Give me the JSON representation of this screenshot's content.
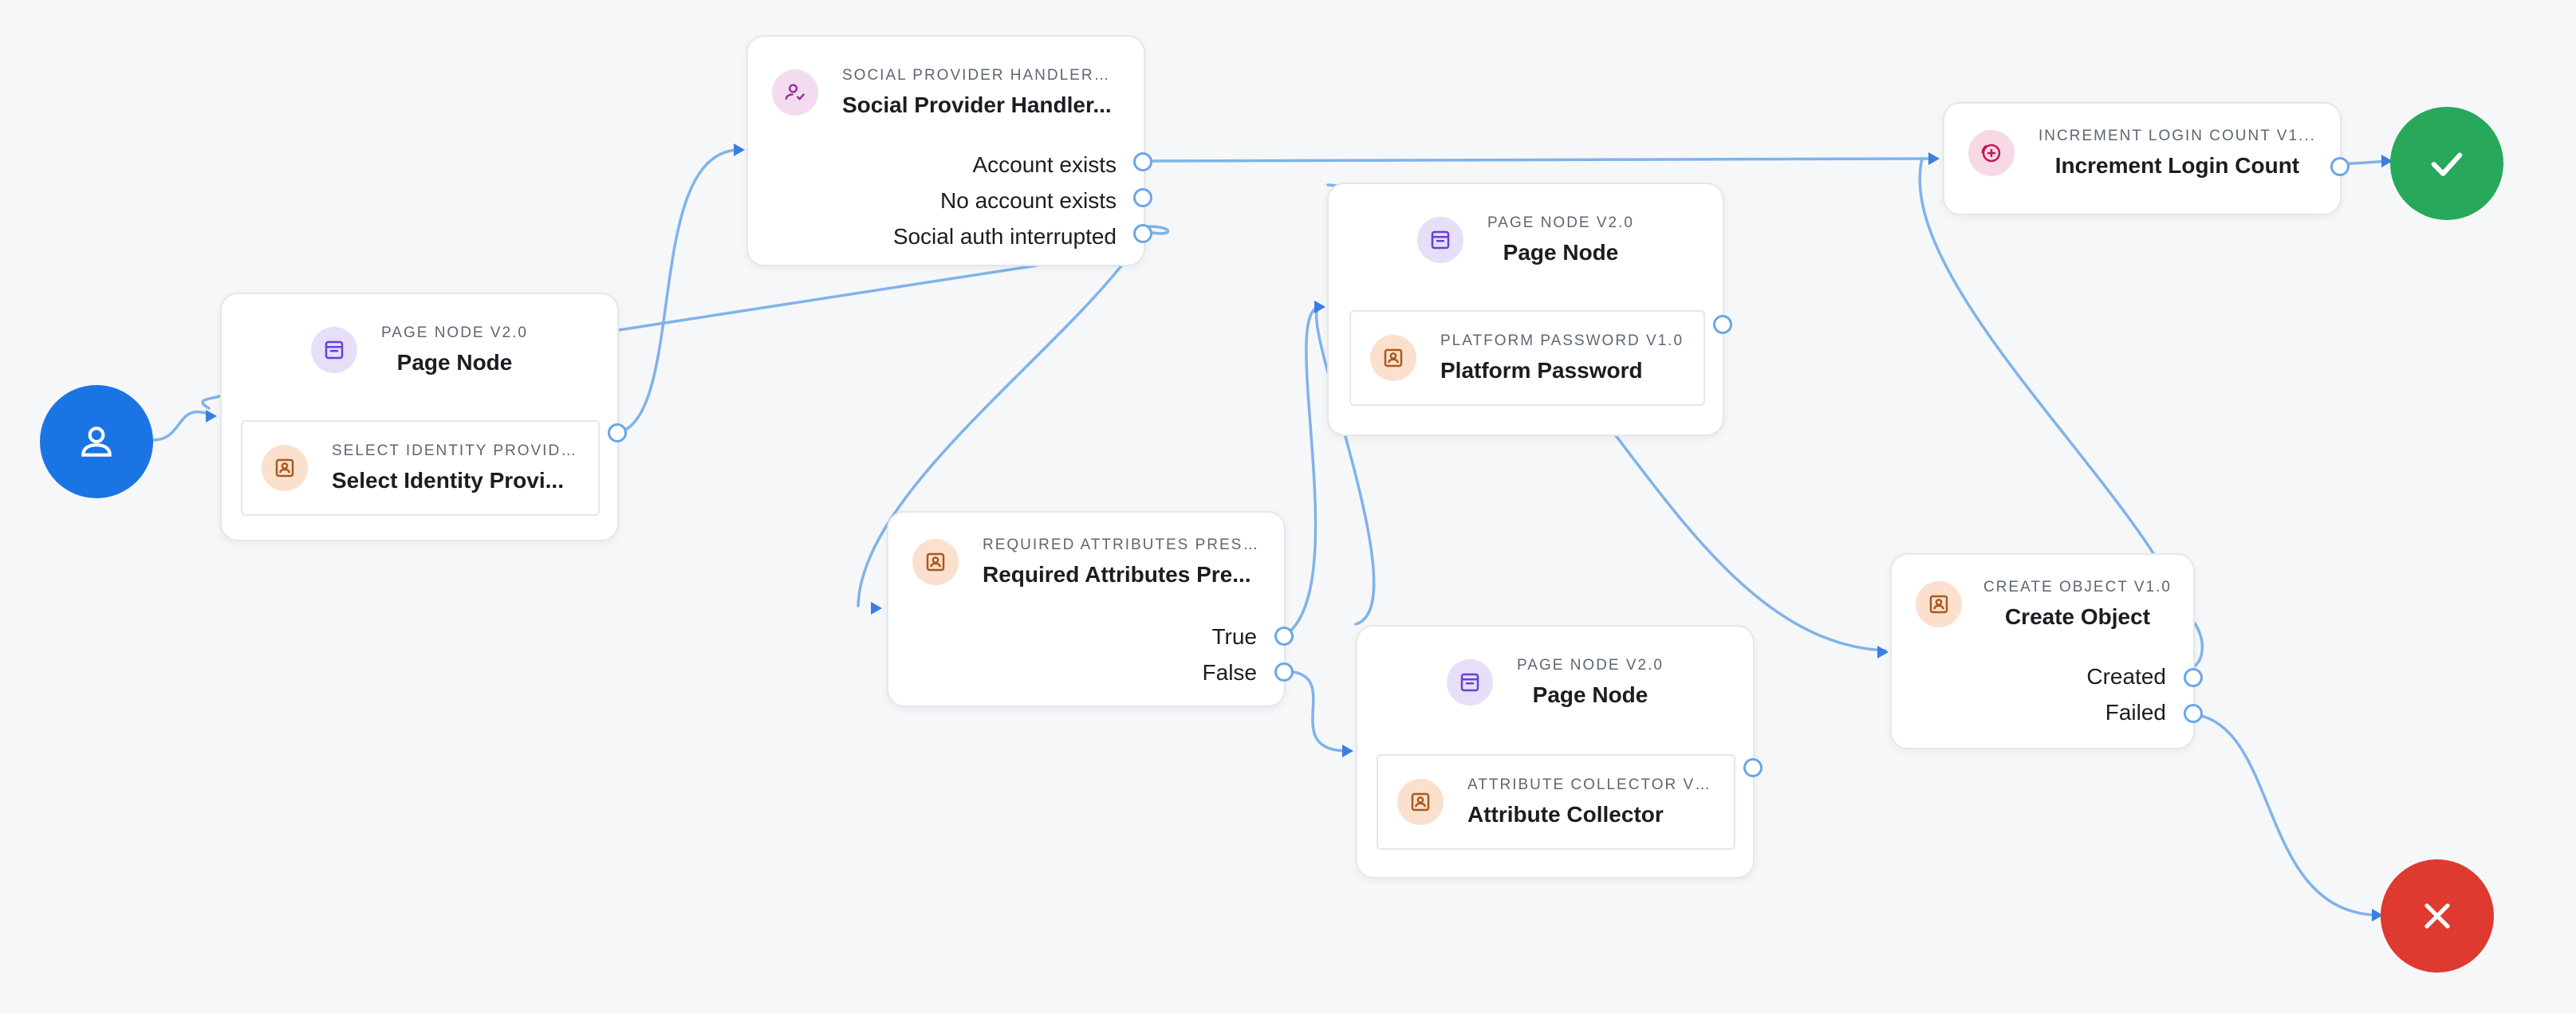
{
  "start": {
    "icon": "user-icon"
  },
  "success": {
    "icon": "check-icon",
    "color": "#27a85a"
  },
  "failure": {
    "icon": "close-icon",
    "color": "#df3a2f"
  },
  "colors": {
    "connector": "#7fb3ea",
    "start": "#1b74e4"
  },
  "nodes": {
    "page1": {
      "type": "PAGE NODE V2.0",
      "name": "Page Node",
      "icon": "page-icon",
      "child": {
        "type": "SELECT IDENTITY PROVIDE...",
        "name": "Select Identity Provi...",
        "icon": "user-card-icon"
      }
    },
    "social": {
      "type": "SOCIAL PROVIDER HANDLER ...",
      "name": "Social Provider Handler...",
      "icon": "user-check-icon",
      "outcomes": [
        "Account exists",
        "No account exists",
        "Social auth interrupted"
      ]
    },
    "page2": {
      "type": "PAGE NODE V2.0",
      "name": "Page Node",
      "icon": "page-icon",
      "child": {
        "type": "PLATFORM PASSWORD V1.0",
        "name": "Platform Password",
        "icon": "user-card-icon"
      }
    },
    "increment": {
      "type": "INCREMENT LOGIN COUNT V1...",
      "name": "Increment Login Count",
      "icon": "plus-circle-icon"
    },
    "required": {
      "type": "REQUIRED ATTRIBUTES PRESE...",
      "name": "Required Attributes Pre...",
      "icon": "user-card-icon",
      "outcomes": [
        "True",
        "False"
      ]
    },
    "page3": {
      "type": "PAGE NODE V2.0",
      "name": "Page Node",
      "icon": "page-icon",
      "child": {
        "type": "ATTRIBUTE COLLECTOR V1...",
        "name": "Attribute Collector",
        "icon": "user-card-icon"
      }
    },
    "create": {
      "type": "CREATE OBJECT V1.0",
      "name": "Create Object",
      "icon": "user-card-icon",
      "outcomes": [
        "Created",
        "Failed"
      ]
    }
  }
}
